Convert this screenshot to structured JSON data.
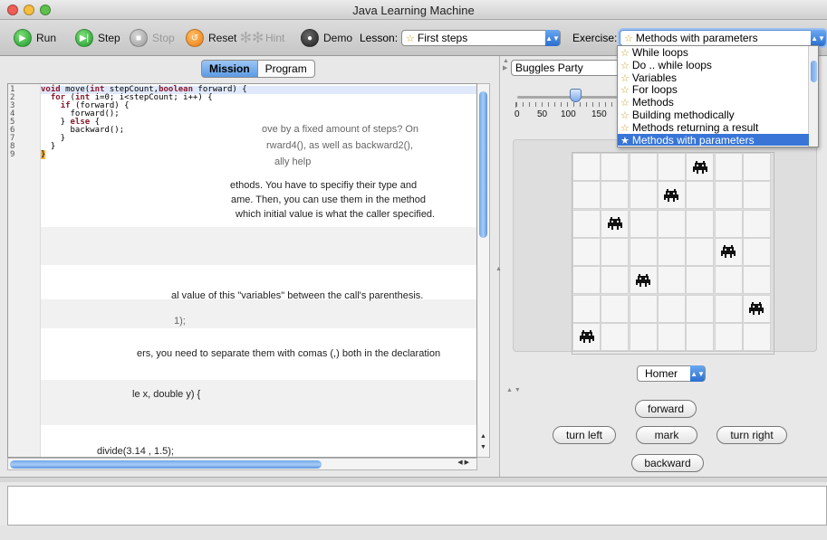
{
  "window": {
    "title": "Java Learning Machine"
  },
  "toolbar": {
    "run": "Run",
    "step": "Step",
    "stop": "Stop",
    "reset": "Reset",
    "hint": "Hint",
    "demo": "Demo",
    "lesson_label": "Lesson:",
    "lesson_value": "First steps",
    "exercise_label": "Exercise:",
    "exercise_value": "Methods with parameters"
  },
  "tabs": {
    "mission": "Mission",
    "program": "Program"
  },
  "editor": {
    "line_numbers": [
      "1",
      "2",
      "3",
      "4",
      "5",
      "6",
      "7",
      "8",
      "9"
    ],
    "code_lines": [
      "void move(int stepCount,boolean forward) {",
      "  for (int i=0; i<stepCount; i++) {",
      "    if (forward) {",
      "      forward();",
      "    } else {",
      "      backward();",
      "    }",
      "  }",
      "}"
    ],
    "mission_fragments": {
      "p1a": "ove by a fixed amount of steps? On",
      "p1b": "rward4(), as well as backward2(),",
      "p1c": "ally help",
      "p2a": "ethods. You have to specifiy their type and",
      "p2b": "ame. Then, you can use them in the method",
      "p2c": "which initial value is what the caller specified.",
      "p3": "al value of this \"variables\" between the call's parenthesis.",
      "p4": "1);",
      "p5": "ers, you need to separate them with comas (,) both in the declaration",
      "p6": "le x, double y) {",
      "p7": "divide(3.14 , 1.5);"
    }
  },
  "world": {
    "selector": "Buggles Party",
    "speed_ticks": [
      "0",
      "50",
      "100",
      "150"
    ],
    "speed_value": 100,
    "grid_size": 7,
    "buggles": [
      {
        "col": 4,
        "row": 0,
        "name": "buggle"
      },
      {
        "col": 3,
        "row": 1,
        "name": "buggle"
      },
      {
        "col": 1,
        "row": 2,
        "name": "buggle"
      },
      {
        "col": 5,
        "row": 3,
        "name": "buggle"
      },
      {
        "col": 2,
        "row": 4,
        "name": "buggle"
      },
      {
        "col": 6,
        "row": 5,
        "name": "buggle"
      },
      {
        "col": 0,
        "row": 6,
        "name": "buggle"
      }
    ],
    "buggle_selector": "Homer",
    "controls": {
      "forward": "forward",
      "turn_left": "turn left",
      "mark": "mark",
      "turn_right": "turn right",
      "backward": "backward"
    }
  },
  "exercise_list": {
    "items": [
      "While loops",
      "Do .. while loops",
      "Variables",
      "For loops",
      "Methods",
      "Building methodically",
      "Methods returning a result",
      "Methods with parameters"
    ],
    "selected_index": 7
  },
  "colors": {
    "selection": "#3875d7",
    "keyword": "#8b1a2b",
    "star": "#c9a227"
  },
  "icons": {
    "run": "play-icon",
    "step": "step-icon",
    "stop": "stop-icon",
    "reset": "reset-icon",
    "hint": "footprints-icon",
    "demo": "demo-icon",
    "star": "star-icon"
  }
}
